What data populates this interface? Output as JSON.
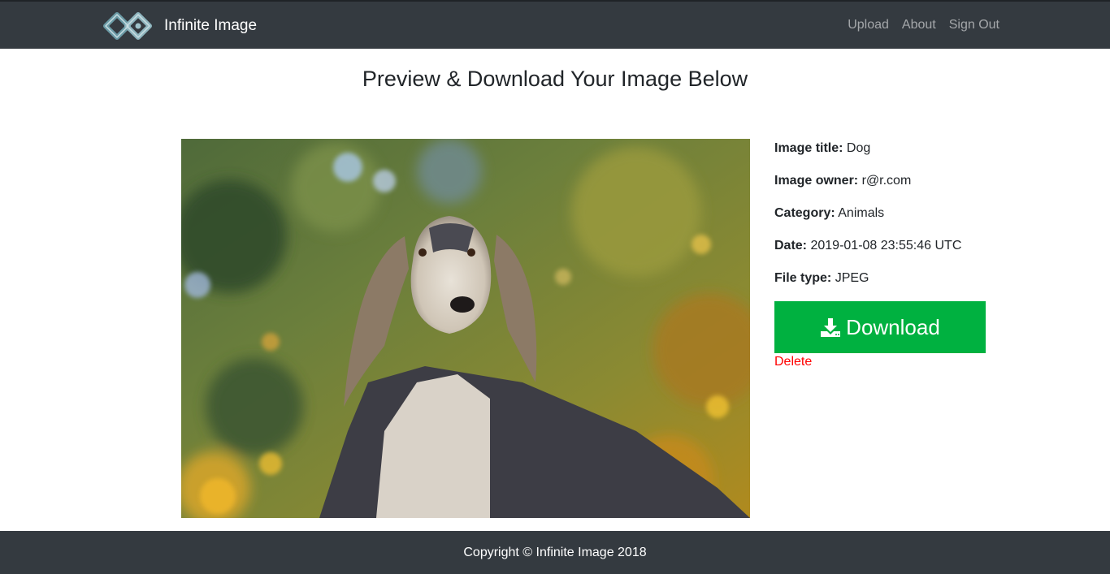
{
  "nav": {
    "brand": "Infinite Image",
    "links": [
      "Upload",
      "About",
      "Sign Out"
    ]
  },
  "page": {
    "title": "Preview & Download Your Image Below"
  },
  "details": {
    "title_label": "Image title:",
    "title_value": "Dog",
    "owner_label": "Image owner:",
    "owner_value": "r@r.com",
    "category_label": "Category:",
    "category_value": "Animals",
    "date_label": "Date:",
    "date_value": "2019-01-08 23:55:46 UTC",
    "filetype_label": "File type:",
    "filetype_value": "JPEG"
  },
  "actions": {
    "download_label": "Download",
    "delete_label": "Delete"
  },
  "footer": {
    "copyright": "Copyright © Infinite Image 2018"
  },
  "colors": {
    "navbar": "#343a40",
    "download": "#00b140",
    "delete": "#ff0000"
  },
  "icons": {
    "logo": "infinity-logo-icon",
    "download": "download-icon"
  }
}
